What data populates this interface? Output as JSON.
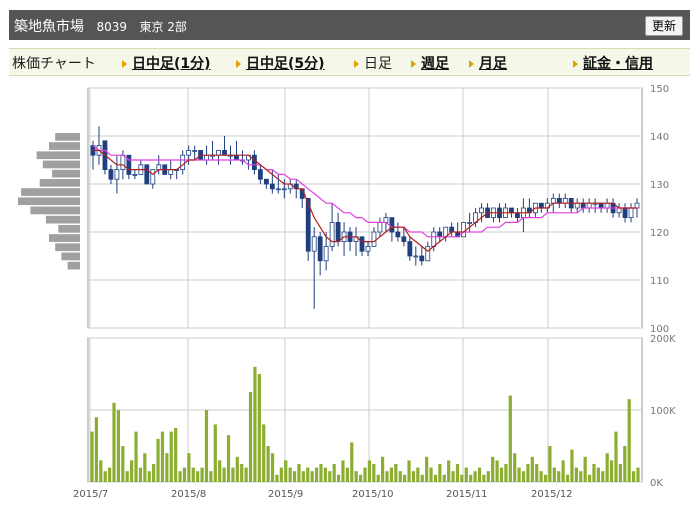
{
  "header": {
    "title": "築地魚市場",
    "code": "8039",
    "market": "東京 2部",
    "refresh_label": "更新"
  },
  "tabs": [
    {
      "label": "株価チャート",
      "link": false,
      "arrow": false
    },
    {
      "label": "日中足(1分)",
      "link": true,
      "arrow": true
    },
    {
      "label": "日中足(5分)",
      "link": true,
      "arrow": true
    },
    {
      "label": "日足",
      "link": false,
      "arrow": true
    },
    {
      "label": "週足",
      "link": true,
      "arrow": true
    },
    {
      "label": "月足",
      "link": true,
      "arrow": true
    },
    {
      "label": "証金・信用",
      "link": true,
      "arrow": true
    }
  ],
  "colors": {
    "up": "#ffffff",
    "down": "#1f3f7f",
    "ma_short": "#b02020",
    "ma_long": "#e23fe2",
    "volume": "#8bad30",
    "volume_profile": "#a0a0a0",
    "grid": "#cccccc"
  },
  "chart_data": [
    {
      "type": "candlestick",
      "title": "",
      "ylim": [
        100,
        150
      ],
      "y_ticks": [
        "150",
        "140",
        "130",
        "120",
        "110",
        "100"
      ],
      "x_ticks": [
        "2015/7",
        "2015/8",
        "2015/9",
        "2015/10",
        "2015/11",
        "2015/12"
      ],
      "candles": [
        [
          138,
          139,
          133,
          136
        ],
        [
          136,
          142,
          134,
          138
        ],
        [
          139,
          139,
          132,
          133
        ],
        [
          133,
          134,
          130,
          131
        ],
        [
          131,
          136,
          128,
          133
        ],
        [
          133,
          137,
          131,
          136
        ],
        [
          136,
          136,
          131,
          132
        ],
        [
          132,
          133,
          131,
          132
        ],
        [
          132,
          135,
          132,
          134
        ],
        [
          134,
          134,
          130,
          130
        ],
        [
          130,
          133,
          129,
          133
        ],
        [
          133,
          136,
          132,
          134
        ],
        [
          134,
          134,
          132,
          132
        ],
        [
          132,
          135,
          131,
          133
        ],
        [
          133,
          133,
          131,
          133
        ],
        [
          133,
          137,
          132,
          136
        ],
        [
          136,
          138,
          134,
          137
        ],
        [
          137,
          138,
          135,
          137
        ],
        [
          137,
          137,
          135,
          135
        ],
        [
          135,
          138,
          134,
          136
        ],
        [
          136,
          139,
          135,
          136
        ],
        [
          136,
          137,
          134,
          137
        ],
        [
          137,
          140,
          136,
          136
        ],
        [
          136,
          138,
          134,
          136
        ],
        [
          136,
          139,
          135,
          135
        ],
        [
          135,
          137,
          134,
          135
        ],
        [
          135,
          136,
          133,
          136
        ],
        [
          136,
          137,
          132,
          133
        ],
        [
          133,
          134,
          130,
          131
        ],
        [
          131,
          131,
          129,
          130
        ],
        [
          130,
          133,
          128,
          129
        ],
        [
          129,
          132,
          128,
          129
        ],
        [
          129,
          131,
          127,
          129
        ],
        [
          129,
          131,
          128,
          130
        ],
        [
          130,
          131,
          127,
          129
        ],
        [
          129,
          129,
          125,
          127
        ],
        [
          127,
          127,
          114,
          116
        ],
        [
          116,
          121,
          104,
          119
        ],
        [
          119,
          120,
          111,
          114
        ],
        [
          114,
          120,
          112,
          117
        ],
        [
          117,
          126,
          116,
          122
        ],
        [
          122,
          124,
          117,
          118
        ],
        [
          118,
          122,
          115,
          120
        ],
        [
          120,
          121,
          116,
          118
        ],
        [
          118,
          121,
          115,
          119
        ],
        [
          119,
          119,
          115,
          116
        ],
        [
          116,
          118,
          115,
          117
        ],
        [
          117,
          121,
          117,
          120
        ],
        [
          120,
          123,
          119,
          122
        ],
        [
          122,
          124,
          120,
          123
        ],
        [
          123,
          123,
          118,
          120
        ],
        [
          120,
          122,
          118,
          119
        ],
        [
          119,
          121,
          117,
          118
        ],
        [
          118,
          119,
          114,
          115
        ],
        [
          115,
          117,
          113,
          115
        ],
        [
          115,
          117,
          113,
          114
        ],
        [
          114,
          118,
          114,
          117
        ],
        [
          117,
          121,
          116,
          120
        ],
        [
          120,
          121,
          118,
          119
        ],
        [
          119,
          121,
          118,
          121
        ],
        [
          121,
          122,
          119,
          120
        ],
        [
          120,
          122,
          119,
          119
        ],
        [
          119,
          122,
          119,
          122
        ],
        [
          122,
          124,
          120,
          122
        ],
        [
          122,
          125,
          121,
          124
        ],
        [
          124,
          126,
          122,
          125
        ],
        [
          125,
          126,
          123,
          123
        ],
        [
          123,
          125,
          122,
          125
        ],
        [
          125,
          126,
          122,
          123
        ],
        [
          123,
          126,
          123,
          125
        ],
        [
          125,
          125,
          123,
          124
        ],
        [
          124,
          125,
          122,
          123
        ],
        [
          123,
          127,
          120,
          125
        ],
        [
          125,
          127,
          123,
          124
        ],
        [
          124,
          126,
          123,
          126
        ],
        [
          126,
          126,
          124,
          125
        ],
        [
          125,
          127,
          124,
          126
        ],
        [
          126,
          128,
          124,
          127
        ],
        [
          127,
          128,
          125,
          126
        ],
        [
          126,
          128,
          125,
          127
        ],
        [
          127,
          127,
          124,
          125
        ],
        [
          125,
          127,
          124,
          126
        ],
        [
          126,
          127,
          124,
          125
        ],
        [
          125,
          127,
          124,
          126
        ],
        [
          126,
          127,
          124,
          126
        ],
        [
          126,
          126,
          124,
          125
        ],
        [
          125,
          127,
          124,
          126
        ],
        [
          126,
          127,
          123,
          124
        ],
        [
          124,
          126,
          123,
          125
        ],
        [
          125,
          126,
          122,
          123
        ],
        [
          123,
          126,
          122,
          125
        ],
        [
          125,
          127,
          123,
          126
        ]
      ],
      "ma_short": [
        137,
        137,
        136,
        135,
        134,
        134,
        133,
        133,
        133,
        133,
        132,
        133,
        133,
        133,
        133,
        134,
        135,
        135,
        136,
        136,
        136,
        136,
        136,
        136,
        136,
        136,
        136,
        135,
        134,
        133,
        132,
        131,
        130,
        130,
        129,
        129,
        126,
        123,
        121,
        119,
        118,
        118,
        119,
        119,
        119,
        118,
        118,
        118,
        119,
        120,
        121,
        121,
        121,
        119,
        118,
        117,
        116,
        117,
        118,
        119,
        120,
        120,
        120,
        121,
        122,
        123,
        124,
        124,
        124,
        124,
        124,
        124,
        124,
        124,
        125,
        125,
        125,
        126,
        126,
        126,
        126,
        126,
        126,
        126,
        126,
        126,
        126,
        126,
        125,
        125,
        125,
        125
      ],
      "ma_long": [
        138,
        137,
        137,
        136,
        136,
        136,
        135,
        135,
        135,
        135,
        135,
        135,
        135,
        135,
        135,
        135,
        135,
        135,
        135,
        135,
        135,
        135,
        135,
        135,
        135,
        135,
        134,
        134,
        134,
        133,
        133,
        132,
        132,
        131,
        131,
        130,
        129,
        128,
        127,
        126,
        126,
        125,
        124,
        124,
        123,
        123,
        122,
        122,
        122,
        122,
        121,
        121,
        121,
        120,
        120,
        120,
        119,
        119,
        119,
        119,
        119,
        119,
        120,
        120,
        120,
        120,
        121,
        121,
        121,
        122,
        122,
        122,
        123,
        123,
        123,
        123,
        124,
        124,
        124,
        124,
        124,
        124,
        125,
        125,
        125,
        125,
        125,
        125,
        125,
        125,
        125,
        125
      ],
      "volume_profile_relative": [
        0.4,
        0.5,
        0.7,
        0.6,
        0.45,
        0.65,
        0.95,
        1.0,
        0.8,
        0.55,
        0.35,
        0.5,
        0.4,
        0.3,
        0.2
      ]
    },
    {
      "type": "bar",
      "title": "",
      "ylim": [
        0,
        200000
      ],
      "y_ticks": [
        "200K",
        "100K",
        "0K"
      ],
      "values": [
        70000,
        90000,
        30000,
        15000,
        20000,
        110000,
        100000,
        50000,
        15000,
        30000,
        70000,
        20000,
        40000,
        15000,
        25000,
        60000,
        70000,
        40000,
        70000,
        75000,
        15000,
        20000,
        40000,
        20000,
        15000,
        20000,
        100000,
        15000,
        80000,
        30000,
        20000,
        65000,
        20000,
        35000,
        25000,
        20000,
        125000,
        160000,
        150000,
        80000,
        50000,
        40000,
        10000,
        20000,
        30000,
        20000,
        15000,
        25000,
        15000,
        20000,
        15000,
        20000,
        25000,
        20000,
        15000,
        25000,
        10000,
        30000,
        20000,
        55000,
        15000,
        10000,
        20000,
        30000,
        25000,
        10000,
        35000,
        15000,
        20000,
        25000,
        15000,
        10000,
        30000,
        15000,
        20000,
        10000,
        35000,
        20000,
        10000,
        25000,
        10000,
        30000,
        15000,
        25000,
        10000,
        20000,
        10000,
        15000,
        20000,
        10000,
        15000,
        35000,
        30000,
        20000,
        25000,
        120000,
        40000,
        20000,
        15000,
        25000,
        35000,
        25000,
        15000,
        10000,
        50000,
        20000,
        15000,
        30000,
        10000,
        45000,
        20000,
        15000,
        35000,
        10000,
        25000,
        20000,
        15000,
        40000,
        30000,
        70000,
        25000,
        50000,
        115000,
        15000,
        20000
      ]
    }
  ]
}
